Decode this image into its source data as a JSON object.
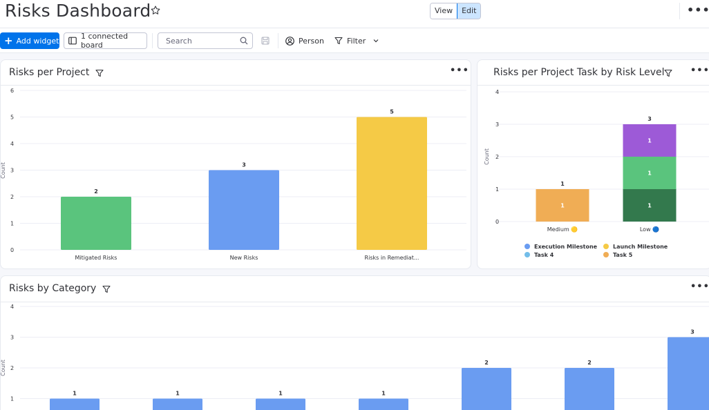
{
  "header": {
    "title": "Risks Dashboard",
    "view_label": "View",
    "edit_label": "Edit",
    "more": "•••"
  },
  "toolbar": {
    "add_widget": "Add widget",
    "connected_boards": "1 connected board",
    "search_placeholder": "Search",
    "person": "Person",
    "filter": "Filter"
  },
  "colors": {
    "primary": "#0073ea",
    "green": "#5ac47d",
    "blue": "#6a9cf1",
    "yellow": "#f5ca46",
    "purple": "#9d5ad7",
    "dark_green": "#33794d",
    "orange": "#f0ad55",
    "light_blue": "#72bde9"
  },
  "widgets": {
    "risks_per_project": {
      "title": "Risks per Project",
      "more": "•••"
    },
    "risks_per_task": {
      "title": "Risks per Project Task by Risk Level",
      "more": "•••"
    },
    "risks_by_category": {
      "title": "Risks by Category",
      "more": "•••"
    }
  },
  "chart_data": [
    {
      "type": "bar",
      "title": "Risks per Project",
      "ylabel": "Count",
      "ylim": [
        0,
        6
      ],
      "yticks": [
        0,
        1,
        2,
        3,
        4,
        5,
        6
      ],
      "categories": [
        "Mitigated Risks",
        "New Risks",
        "Risks in Remediat..."
      ],
      "values": [
        2,
        3,
        5
      ],
      "colors": [
        "#5ac47d",
        "#6a9cf1",
        "#f5ca46"
      ],
      "grid": true
    },
    {
      "type": "bar",
      "stacked": true,
      "title": "Risks per Project Task by Risk Level",
      "ylabel": "Count",
      "ylim": [
        0,
        4
      ],
      "yticks": [
        0,
        1,
        2,
        3,
        4
      ],
      "categories": [
        "Medium 🟡",
        "Low 🔵"
      ],
      "totals": [
        1,
        3
      ],
      "segments": [
        {
          "category": "Medium 🟡",
          "value": 1,
          "color": "#f0ad55"
        },
        {
          "category": "Low 🔵",
          "value": 1,
          "color": "#33794d"
        },
        {
          "category": "Low 🔵",
          "value": 1,
          "color": "#5ac47d"
        },
        {
          "category": "Low 🔵",
          "value": 1,
          "color": "#9d5ad7"
        }
      ],
      "legend": [
        {
          "name": "Execution Milestone",
          "color": "#6a9cf1"
        },
        {
          "name": "Launch Milestone",
          "color": "#f5ca46"
        },
        {
          "name": "Task 4",
          "color": "#72bde9"
        },
        {
          "name": "Task 5",
          "color": "#f0ad55"
        }
      ],
      "legend_placement": "bottom",
      "grid": true
    },
    {
      "type": "bar",
      "title": "Risks by Category",
      "ylabel": "Count",
      "ylim": [
        0,
        4
      ],
      "yticks": [
        1,
        2,
        3,
        4
      ],
      "values": [
        1,
        1,
        1,
        1,
        2,
        2,
        3
      ],
      "color": "#6a9cf1",
      "grid": true
    }
  ]
}
